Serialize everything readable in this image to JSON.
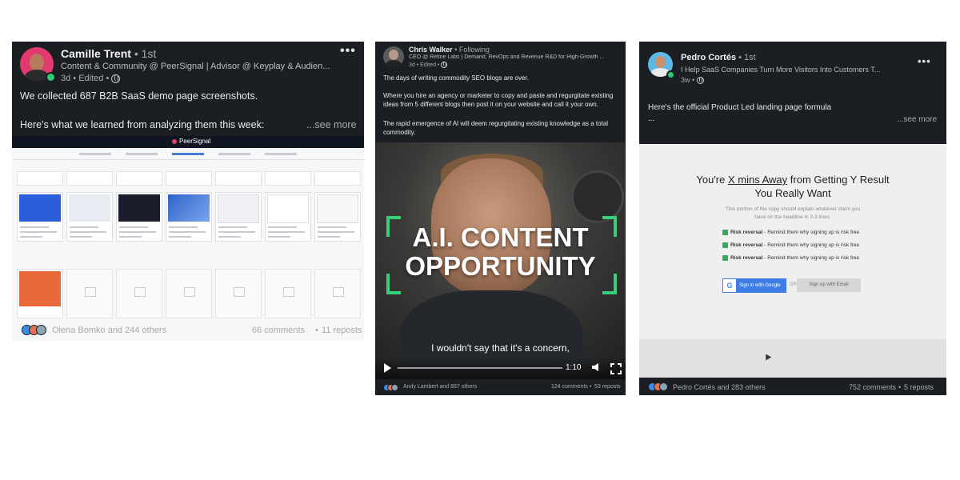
{
  "post1": {
    "author": "Camille Trent",
    "degree": "• 1st",
    "headline": "Content & Community @ PeerSignal | Advisor @ Keyplay & Audien...",
    "meta": "3d • Edited •",
    "text1": "We collected 687 B2B SaaS demo page screenshots.",
    "text2": "Here's what we learned from analyzing them this week:",
    "see_more": "...see more",
    "media_brand": "PeerSignal",
    "reactors": "Olena Bomko and 244 others",
    "comments": "66 comments",
    "reposts": "11 reposts",
    "colors": {
      "avatar": "#e23a6f",
      "accent": "#4a7bd6"
    }
  },
  "post2": {
    "author": "Chris Walker",
    "degree": "• Following",
    "headline": "CEO @ Refine Labs | Demand, RevOps and Revenue R&D for High-Growth ...",
    "meta": "3d • Edited •",
    "p1": "The days of writing commodity SEO blogs are over.",
    "p2": "Where you hire an agency or marketer to copy and paste and regurgitate existing ideas from 5 different blogs then post it on your website and call it your own.",
    "p3": "The rapid emergence of AI will deem regurgitating existing knowledge as a total commodity.",
    "video_title_1": "A.I. CONTENT",
    "video_title_2": "OPPORTUNITY",
    "subtitle": "I wouldn't say that it's a concern,",
    "time": "1:10",
    "reactors": "Andy Lambert and 897 others",
    "comments": "124 comments",
    "reposts": "53 reposts",
    "colors": {
      "bracket": "#36d07a"
    }
  },
  "post3": {
    "author": "Pedro Cortés",
    "degree": "• 1st",
    "headline": "I Help SaaS Companies Turn More Visitors Into Customers T...",
    "meta": "3w •",
    "text1": "Here's the official Product Led landing page formula",
    "text_ellipsis": "...",
    "see_more": "...see more",
    "lp_h1_a": "You're ",
    "lp_h1_u": "X mins Away",
    "lp_h1_b": " from Getting Y Result",
    "lp_h2": "You Really Want",
    "lp_p": "This portion of the copy should explain whatever claim you have on the headline in 2-3 lines.",
    "risk_bold": "Risk reversal",
    "risk_rest": " - Remind them why signing up is risk free",
    "google_btn": "Sign in with Google",
    "or": "OR",
    "email_btn": "Sign up with Email",
    "reactors": "Pedro Cortés and 283 others",
    "comments": "752 comments",
    "reposts": "5 reposts",
    "colors": {
      "google": "#3f7de6",
      "check": "#3ca55c"
    }
  }
}
